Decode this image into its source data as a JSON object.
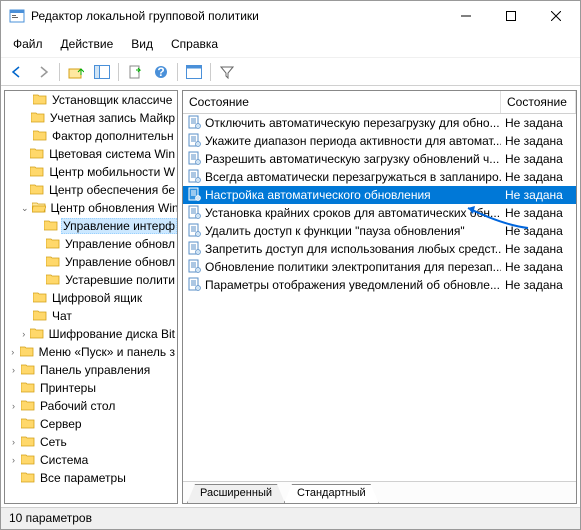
{
  "window": {
    "title": "Редактор локальной групповой политики"
  },
  "menu": {
    "file": "Файл",
    "action": "Действие",
    "view": "Вид",
    "help": "Справка"
  },
  "tree": {
    "items": [
      {
        "label": "Установщик классиче",
        "level": 1,
        "open": false,
        "expand": ""
      },
      {
        "label": "Учетная запись Майкр",
        "level": 1,
        "open": false,
        "expand": ""
      },
      {
        "label": "Фактор дополнительн",
        "level": 1,
        "open": false,
        "expand": ""
      },
      {
        "label": "Цветовая система Win",
        "level": 1,
        "open": false,
        "expand": ""
      },
      {
        "label": "Центр мобильности W",
        "level": 1,
        "open": false,
        "expand": ""
      },
      {
        "label": "Центр обеспечения бе",
        "level": 1,
        "open": false,
        "expand": ""
      },
      {
        "label": "Центр обновления Win",
        "level": 1,
        "open": true,
        "expand": "⌄"
      },
      {
        "label": "Управление интерф",
        "level": 2,
        "open": false,
        "expand": "",
        "selected": true
      },
      {
        "label": "Управление обновл",
        "level": 2,
        "open": false,
        "expand": ""
      },
      {
        "label": "Управление обновл",
        "level": 2,
        "open": false,
        "expand": ""
      },
      {
        "label": "Устаревшие полити",
        "level": 2,
        "open": false,
        "expand": ""
      },
      {
        "label": "Цифровой ящик",
        "level": 1,
        "open": false,
        "expand": ""
      },
      {
        "label": "Чат",
        "level": 1,
        "open": false,
        "expand": ""
      },
      {
        "label": "Шифрование диска Bit",
        "level": 1,
        "open": false,
        "expand": "›"
      },
      {
        "label": "Меню «Пуск» и панель з",
        "level": 0,
        "open": false,
        "expand": "›"
      },
      {
        "label": "Панель управления",
        "level": 0,
        "open": false,
        "expand": "›"
      },
      {
        "label": "Принтеры",
        "level": 0,
        "open": false,
        "expand": ""
      },
      {
        "label": "Рабочий стол",
        "level": 0,
        "open": false,
        "expand": "›"
      },
      {
        "label": "Сервер",
        "level": 0,
        "open": false,
        "expand": ""
      },
      {
        "label": "Сеть",
        "level": 0,
        "open": false,
        "expand": "›"
      },
      {
        "label": "Система",
        "level": 0,
        "open": false,
        "expand": "›"
      },
      {
        "label": "Все параметры",
        "level": 0,
        "open": false,
        "expand": ""
      }
    ]
  },
  "list": {
    "col_name": "Состояние",
    "col_state": "Состояние",
    "rows": [
      {
        "name": "Отключить автоматическую перезагрузку для обно...",
        "state": "Не задана"
      },
      {
        "name": "Укажите диапазон периода активности для автомат...",
        "state": "Не задана"
      },
      {
        "name": "Разрешить автоматическую загрузку обновлений ч...",
        "state": "Не задана"
      },
      {
        "name": "Всегда автоматически перезагружаться в запланиро...",
        "state": "Не задана"
      },
      {
        "name": "Настройка автоматического обновления",
        "state": "Не задана",
        "selected": true
      },
      {
        "name": "Установка крайних сроков для автоматических обн...",
        "state": "Не задана"
      },
      {
        "name": "Удалить доступ к функции \"пауза обновления\"",
        "state": "Не задана"
      },
      {
        "name": "Запретить доступ для использования любых средст...",
        "state": "Не задана"
      },
      {
        "name": "Обновление политики электропитания для перезап...",
        "state": "Не задана"
      },
      {
        "name": "Параметры отображения уведомлений об обновле...",
        "state": "Не задана"
      }
    ]
  },
  "tabs": {
    "extended": "Расширенный",
    "standard": "Стандартный"
  },
  "status": {
    "text": "10 параметров"
  }
}
